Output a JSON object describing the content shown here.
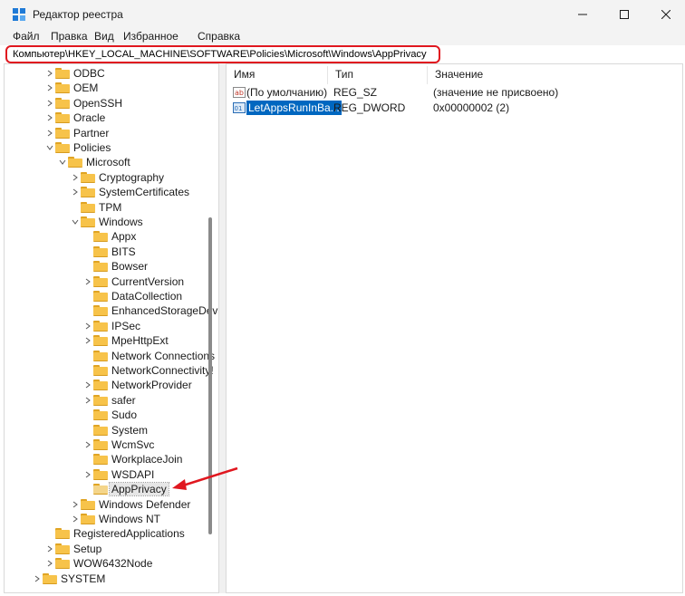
{
  "window": {
    "title": "Редактор реестра"
  },
  "menu": [
    "Файл",
    "Правка",
    "Вид",
    "Избранное",
    "Справка"
  ],
  "address": {
    "path": "Компьютер\\HKEY_LOCAL_MACHINE\\SOFTWARE\\Policies\\Microsoft\\Windows\\AppPrivacy"
  },
  "tree": [
    {
      "label": "ODBC",
      "level": 0,
      "chevron": "right"
    },
    {
      "label": "OEM",
      "level": 0,
      "chevron": "right"
    },
    {
      "label": "OpenSSH",
      "level": 0,
      "chevron": "right"
    },
    {
      "label": "Oracle",
      "level": 0,
      "chevron": "right"
    },
    {
      "label": "Partner",
      "level": 0,
      "chevron": "right"
    },
    {
      "label": "Policies",
      "level": 0,
      "chevron": "down"
    },
    {
      "label": "Microsoft",
      "level": 1,
      "chevron": "down"
    },
    {
      "label": "Cryptography",
      "level": 2,
      "chevron": "right"
    },
    {
      "label": "SystemCertificates",
      "level": 2,
      "chevron": "right"
    },
    {
      "label": "TPM",
      "level": 2,
      "chevron": ""
    },
    {
      "label": "Windows",
      "level": 2,
      "chevron": "down"
    },
    {
      "label": "Appx",
      "level": 3,
      "chevron": ""
    },
    {
      "label": "BITS",
      "level": 3,
      "chevron": ""
    },
    {
      "label": "Bowser",
      "level": 3,
      "chevron": ""
    },
    {
      "label": "CurrentVersion",
      "level": 3,
      "chevron": "right"
    },
    {
      "label": "DataCollection",
      "level": 3,
      "chevron": ""
    },
    {
      "label": "EnhancedStorageDevi",
      "level": 3,
      "chevron": ""
    },
    {
      "label": "IPSec",
      "level": 3,
      "chevron": "right"
    },
    {
      "label": "MpeHttpExt",
      "level": 3,
      "chevron": "right"
    },
    {
      "label": "Network Connections",
      "level": 3,
      "chevron": ""
    },
    {
      "label": "NetworkConnectivity!",
      "level": 3,
      "chevron": ""
    },
    {
      "label": "NetworkProvider",
      "level": 3,
      "chevron": "right"
    },
    {
      "label": "safer",
      "level": 3,
      "chevron": "right"
    },
    {
      "label": "Sudo",
      "level": 3,
      "chevron": ""
    },
    {
      "label": "System",
      "level": 3,
      "chevron": ""
    },
    {
      "label": "WcmSvc",
      "level": 3,
      "chevron": "right"
    },
    {
      "label": "WorkplaceJoin",
      "level": 3,
      "chevron": ""
    },
    {
      "label": "WSDAPI",
      "level": 3,
      "chevron": "right"
    },
    {
      "label": "AppPrivacy",
      "level": 3,
      "chevron": "",
      "selected": true
    },
    {
      "label": "Windows Defender",
      "level": 2,
      "chevron": "right"
    },
    {
      "label": "Windows NT",
      "level": 2,
      "chevron": "right"
    },
    {
      "label": "RegisteredApplications",
      "level": 0,
      "chevron": ""
    },
    {
      "label": "Setup",
      "level": 0,
      "chevron": "right"
    },
    {
      "label": "WOW6432Node",
      "level": 0,
      "chevron": "right"
    },
    {
      "label": "SYSTEM",
      "level": -1,
      "chevron": "right"
    }
  ],
  "columns": {
    "name": "Имя",
    "type": "Тип",
    "value": "Значение"
  },
  "values": [
    {
      "icon": "string-value-icon",
      "name": "(По умолчанию)",
      "type": "REG_SZ",
      "data": "(значение не присвоено)",
      "selected": false
    },
    {
      "icon": "dword-value-icon",
      "name": "LetAppsRunInBa...",
      "type": "REG_DWORD",
      "data": "0x00000002 (2)",
      "selected": true
    }
  ],
  "colors": {
    "highlight": "#0067c0",
    "address_border": "#e0171f",
    "arrow": "#e0171f",
    "folder": "#f7c34a"
  }
}
